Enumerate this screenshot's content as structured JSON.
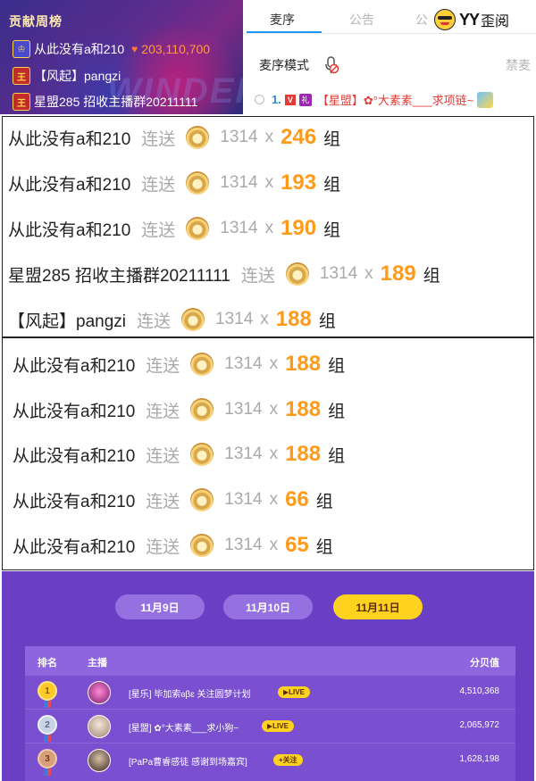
{
  "rank_panel": {
    "title": "贡献周榜",
    "rows": [
      {
        "badge": "♔",
        "name": "从此没有a和210",
        "amount": "203,110,700"
      },
      {
        "badge": "王",
        "name": "【风起】pangzi",
        "amount": ""
      },
      {
        "badge": "王",
        "name": "星盟285 招收主播群20211111",
        "amount": ""
      }
    ]
  },
  "mic_panel": {
    "tabs": [
      "麦序",
      "公告",
      "公"
    ],
    "logo_text": "YY",
    "logo_cn": "歪阅",
    "mic_mode_label": "麦序模式",
    "ban_label": "禁麦",
    "queue": {
      "index": "1.",
      "v_badge": "V",
      "gift_badge": "礼",
      "name": "【星盟】✿°大素素___求项链~"
    }
  },
  "gift_box_1": [
    {
      "sender": "从此没有a和210",
      "verb": "连送",
      "value": "1314",
      "x": "x",
      "count": "246",
      "unit": "组"
    },
    {
      "sender": "从此没有a和210",
      "verb": "连送",
      "value": "1314",
      "x": "x",
      "count": "193",
      "unit": "组"
    },
    {
      "sender": "从此没有a和210",
      "verb": "连送",
      "value": "1314",
      "x": "x",
      "count": "190",
      "unit": "组"
    },
    {
      "sender": "星盟285 招收主播群20211111",
      "verb": "连送",
      "value": "1314",
      "x": "x",
      "count": "189",
      "unit": "组"
    },
    {
      "sender": "【风起】pangzi",
      "verb": "连送",
      "value": "1314",
      "x": "x",
      "count": "188",
      "unit": "组"
    }
  ],
  "gift_box_2": [
    {
      "sender": "从此没有a和210",
      "verb": "连送",
      "value": "1314",
      "x": "x",
      "count": "188",
      "unit": "组"
    },
    {
      "sender": "从此没有a和210",
      "verb": "连送",
      "value": "1314",
      "x": "x",
      "count": "188",
      "unit": "组"
    },
    {
      "sender": "从此没有a和210",
      "verb": "连送",
      "value": "1314",
      "x": "x",
      "count": "188",
      "unit": "组"
    },
    {
      "sender": "从此没有a和210",
      "verb": "连送",
      "value": "1314",
      "x": "x",
      "count": "66",
      "unit": "组"
    },
    {
      "sender": "从此没有a和210",
      "verb": "连送",
      "value": "1314",
      "x": "x",
      "count": "65",
      "unit": "组"
    }
  ],
  "leaderboard": {
    "dates": [
      {
        "label": "11月9日",
        "active": false
      },
      {
        "label": "11月10日",
        "active": false
      },
      {
        "label": "11月11日",
        "active": true
      }
    ],
    "headers": {
      "rank": "排名",
      "host": "主播",
      "score": "分贝值"
    },
    "rows": [
      {
        "rank": "1",
        "name": "[星乐] 毕加索ɞβɛ 关注圆梦计划",
        "tag": "▶LIVE",
        "score": "4,510,368"
      },
      {
        "rank": "2",
        "name": "[星盟] ✿°大素素___求小狗~",
        "tag": "▶LIVE",
        "score": "2,065,972"
      },
      {
        "rank": "3",
        "name": "[PaPa曹睿感徒 感谢到场嘉宾]",
        "tag": "+关注",
        "score": "1,628,198"
      }
    ]
  },
  "colors": {
    "accent_blue": "#2196f3",
    "count_orange": "#ff9a1a",
    "lb_purple": "#6b3fc4",
    "pill_yellow": "#ffd21f"
  }
}
